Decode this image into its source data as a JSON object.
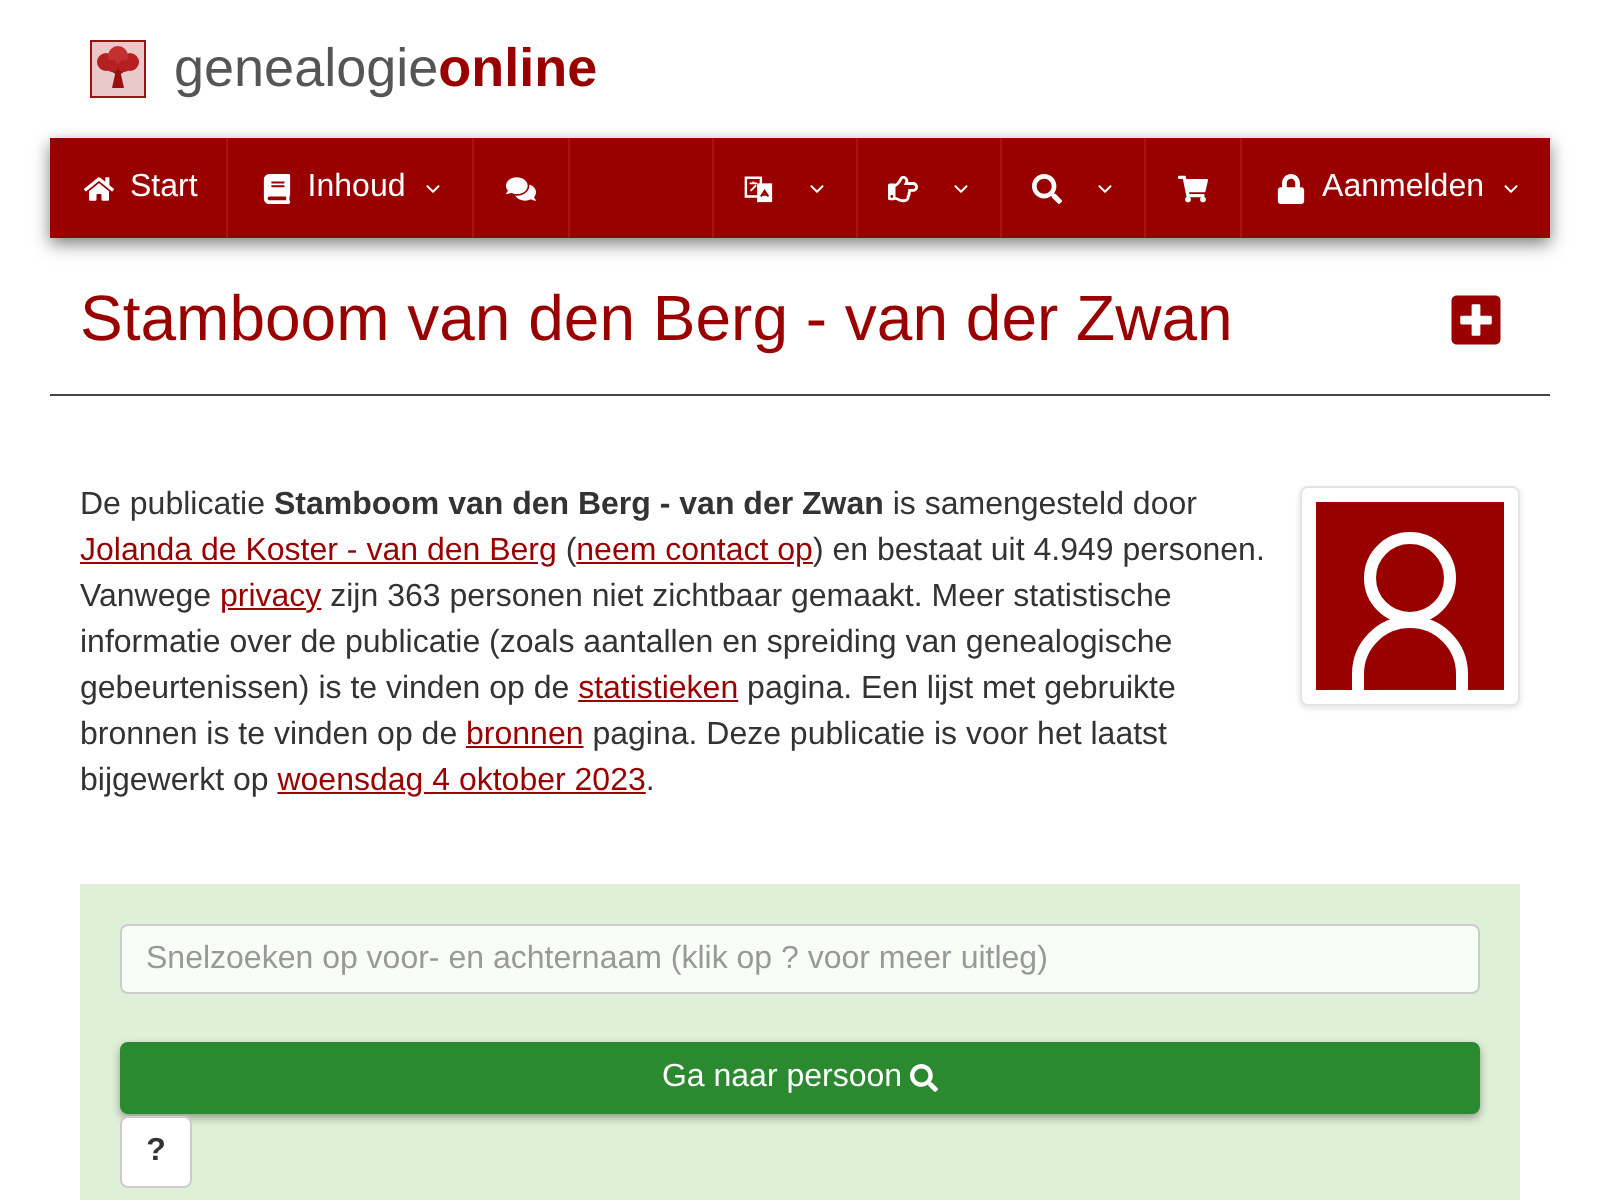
{
  "logo": {
    "text": "genealogie**online**"
  },
  "nav": {
    "left": [
      {
        "label": "Start",
        "dropdown": false
      },
      {
        "label": "Inhoud",
        "dropdown": true
      },
      {
        "dropdown": false
      }
    ],
    "right": [
      {
        "dropdown": true
      },
      {
        "dropdown": true
      },
      {
        "dropdown": true
      },
      {
        "dropdown": false
      },
      {
        "label": "Aanmelden",
        "dropdown": true
      }
    ]
  },
  "page_title": "Stamboom van den Berg - van der Zwan",
  "description": [
    {
      "kind": "text",
      "text": "De publicatie "
    },
    {
      "kind": "bold",
      "text": "Stamboom van den Berg - van der Zwan"
    },
    {
      "kind": "text",
      "text": " is samengesteld door "
    },
    {
      "kind": "link",
      "text": "Jolanda de Koster - van den Berg"
    },
    {
      "kind": "text",
      "text": " ("
    },
    {
      "kind": "link",
      "text": "neem contact op"
    },
    {
      "kind": "text",
      "text": ") en bestaat uit 4.949 personen. Vanwege "
    },
    {
      "kind": "link",
      "text": "privacy"
    },
    {
      "kind": "text",
      "text": " zijn 363 personen niet zichtbaar gemaakt. Meer statistische informatie over de publicatie (zoals aantallen en spreiding van genealogische gebeurtenissen) is te vinden op de "
    },
    {
      "kind": "link",
      "text": "statistieken"
    },
    {
      "kind": "text",
      "text": " pagina. Een lijst met gebruikte bronnen is te vinden op de "
    },
    {
      "kind": "link",
      "text": "bronnen"
    },
    {
      "kind": "text",
      "text": " pagina. Deze publicatie is voor het laatst bijgewerkt op "
    },
    {
      "kind": "link",
      "text": "woensdag 4 oktober 2023"
    },
    {
      "kind": "text",
      "text": "."
    }
  ],
  "search": {
    "placeholder": "Snelzoeken op voor- en achternaam (klik op ? voor meer uitleg)",
    "button": "Ga naar persoon",
    "help_button": "?"
  }
}
